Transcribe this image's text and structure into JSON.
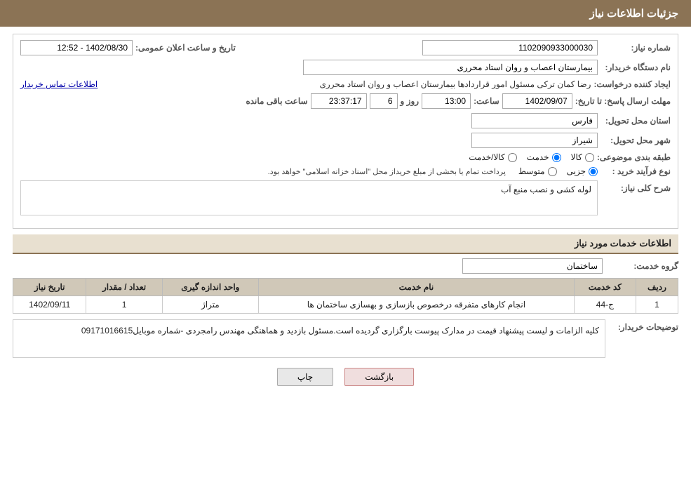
{
  "header": {
    "title": "جزئیات اطلاعات نیاز"
  },
  "form": {
    "shomara_niaz_label": "شماره نیاز:",
    "shomara_niaz_value": "1102090933000030",
    "nam_dastgah_label": "نام دستگاه خریدار:",
    "nam_dastgah_value": "بیمارستان اعصاب و روان استاد محرری",
    "ijad_konande_label": "ایجاد کننده درخواست:",
    "ijad_konande_value": "رضا کمان ترکی مسئول امور قراردادها بیمارستان اعصاب و روان استاد محرری",
    "contact_link": "اطلاعات تماس خریدار",
    "mohlat_label": "مهلت ارسال پاسخ: تا تاریخ:",
    "mohlat_date": "1402/09/07",
    "mohlat_time_label": "ساعت:",
    "mohlat_time": "13:00",
    "mohlat_roz_label": "روز و",
    "mohlat_roz": "6",
    "mohlat_saat_mande_label": "ساعت باقی مانده",
    "mohlat_saat_mande": "23:37:17",
    "tarikh_elan_label": "تاریخ و ساعت اعلان عمومی:",
    "tarikh_elan_value": "1402/08/30 - 12:52",
    "ostan_label": "استان محل تحویل:",
    "ostan_value": "فارس",
    "shahr_label": "شهر محل تحویل:",
    "shahr_value": "شیراز",
    "tabaqe_label": "طبقه بندی موضوعی:",
    "tabaqe_options": [
      {
        "label": "کالا",
        "value": "kala"
      },
      {
        "label": "خدمت",
        "value": "khedmat"
      },
      {
        "label": "کالا/خدمت",
        "value": "kala_khedmat"
      }
    ],
    "tabaqe_selected": "khedmat",
    "navae_label": "نوع فرآیند خرید :",
    "navae_options": [
      {
        "label": "جزیی",
        "value": "jozi"
      },
      {
        "label": "متوسط",
        "value": "motavaset"
      }
    ],
    "navae_selected": "jozi",
    "navae_note": "پرداخت تمام یا بخشی از مبلغ خریداز محل \"اسناد خزانه اسلامی\" خواهد بود.",
    "sharh_niaz_label": "شرح کلی نیاز:",
    "sharh_niaz_value": "لوله کشی و نصب منبع آب",
    "khadamat_title": "اطلاعات خدمات مورد نیاز",
    "gorohe_khedmat_label": "گروه خدمت:",
    "gorohe_khedmat_value": "ساختمان",
    "table": {
      "headers": [
        "ردیف",
        "کد خدمت",
        "نام خدمت",
        "واحد اندازه گیری",
        "تعداد / مقدار",
        "تاریخ نیاز"
      ],
      "rows": [
        {
          "radif": "1",
          "kod": "ج-44",
          "nam": "انجام کارهای متفرقه درخصوص بازسازی و بهسازی ساختمان ها",
          "vahed": "متراژ",
          "tedad": "1",
          "tarikh": "1402/09/11"
        }
      ]
    },
    "toseeh_label": "توضیحات خریدار:",
    "toseeh_value": "کلیه الزامات و لیست پیشنهاد قیمت در مدارک پیوست بارگزاری گردیده است.مسئول بازدید و هماهنگی مهندس رامجردی -شماره موبایل09171016615"
  },
  "buttons": {
    "back_label": "بازگشت",
    "print_label": "چاپ"
  }
}
